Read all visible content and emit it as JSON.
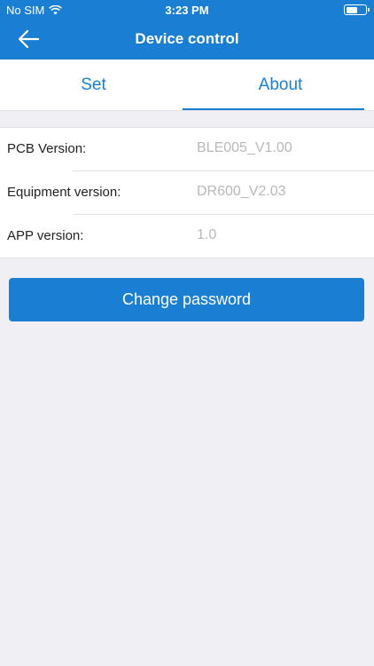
{
  "status_bar": {
    "carrier": "No SIM",
    "time": "3:23 PM",
    "battery_level": 0.6
  },
  "nav": {
    "title": "Device control",
    "back_icon": "arrow-left-icon"
  },
  "tabs": [
    {
      "label": "Set",
      "active": false
    },
    {
      "label": "About",
      "active": true
    }
  ],
  "info": [
    {
      "label": "PCB Version:",
      "value": "BLE005_V1.00"
    },
    {
      "label": "Equipment version:",
      "value": "DR600_V2.03"
    },
    {
      "label": "APP version:",
      "value": "1.0"
    }
  ],
  "actions": {
    "change_password_label": "Change password"
  },
  "colors": {
    "accent": "#1a7fd2",
    "background": "#efeff4",
    "value_text": "#b8b8bd"
  }
}
